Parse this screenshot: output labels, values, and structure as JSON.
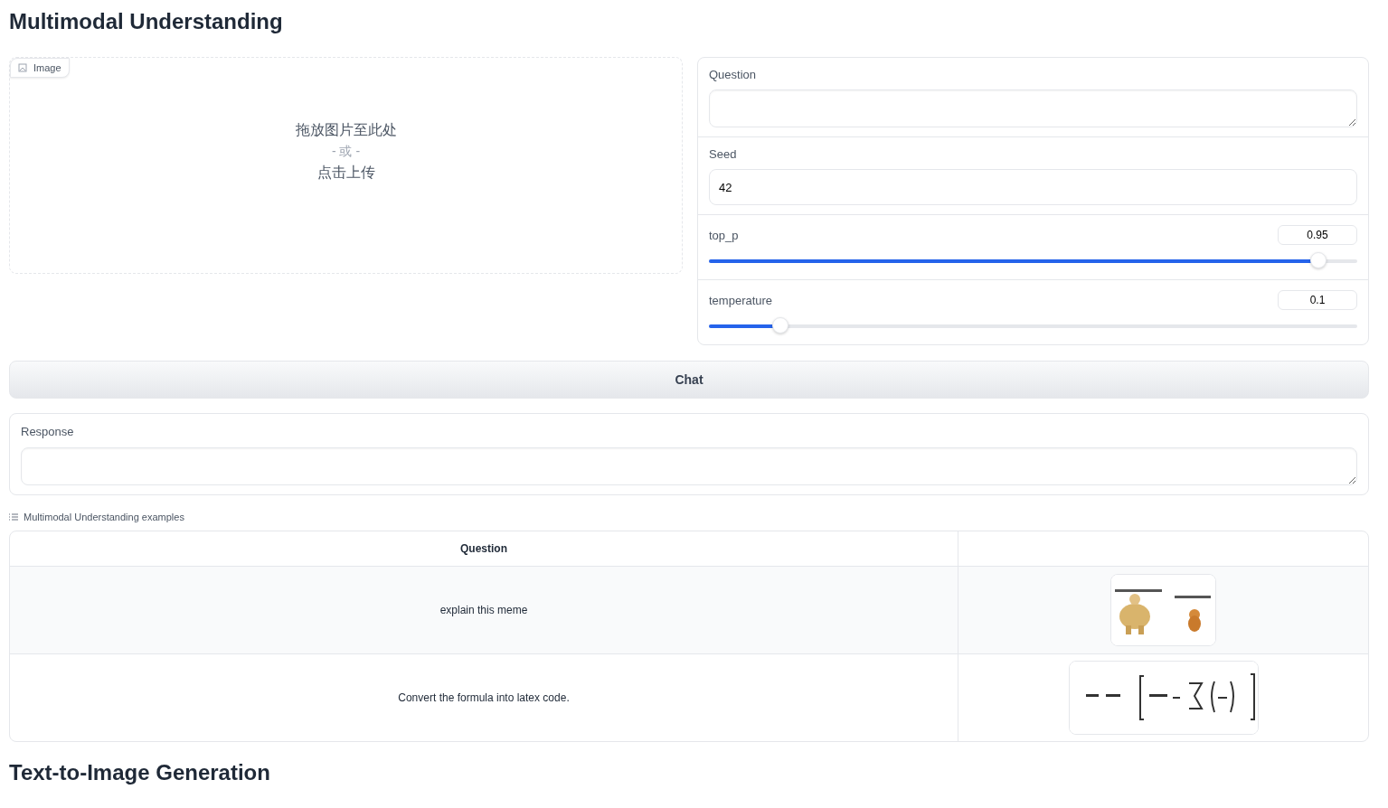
{
  "title": "Multimodal Understanding",
  "image_upload": {
    "label": "Image",
    "drop_text": "拖放图片至此处",
    "or_text": "- 或 -",
    "click_text": "点击上传"
  },
  "question": {
    "label": "Question"
  },
  "seed": {
    "label": "Seed",
    "value": "42"
  },
  "sliders": [
    {
      "label": "top_p",
      "value": "0.95",
      "level": 0.94
    },
    {
      "label": "temperature",
      "value": "0.1",
      "level": 0.11
    }
  ],
  "chat_button": "Chat",
  "response": {
    "label": "Response"
  },
  "examples": {
    "label": "Multimodal Understanding examples",
    "columns": [
      {
        "label": "Question"
      }
    ],
    "rows": [
      {
        "question": "explain this meme",
        "image": {
          "kind": "meme"
        }
      },
      {
        "question": "Convert the formula into latex code.",
        "image": {
          "kind": "formula"
        }
      }
    ]
  },
  "next_title": "Text-to-Image Generation"
}
